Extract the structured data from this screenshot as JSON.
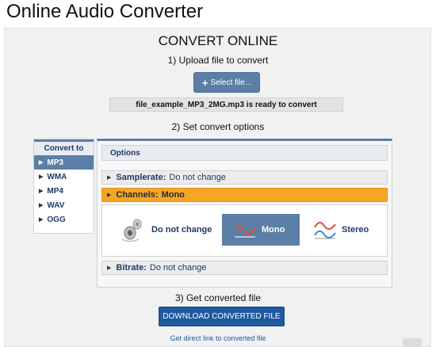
{
  "app": {
    "title": "Online Audio Converter"
  },
  "main": {
    "heading": "CONVERT ONLINE",
    "step1": "1) Upload file to convert",
    "select_file_label": "Select file...",
    "file_status": "file_example_MP3_2MG.mp3 is ready to convert",
    "step2": "2) Set convert options",
    "step3": "3) Get converted file",
    "download_label": "DOWNLOAD CONVERTED FILE",
    "direct_link": "Get direct link to converted file"
  },
  "sidebar": {
    "header": "Convert to",
    "items": [
      {
        "label": "MP3",
        "active": true
      },
      {
        "label": "WMA",
        "active": false
      },
      {
        "label": "MP4",
        "active": false
      },
      {
        "label": "WAV",
        "active": false
      },
      {
        "label": "OGG",
        "active": false
      }
    ]
  },
  "options": {
    "header": "Options",
    "samplerate": {
      "name": "Samplerate:",
      "value": "Do not change"
    },
    "channels": {
      "name": "Channels:",
      "value": "Mono",
      "choices": [
        {
          "label": "Do not change",
          "icon": "speaker-icon",
          "selected": false
        },
        {
          "label": "Mono",
          "icon": "mono-wave-icon",
          "selected": true
        },
        {
          "label": "Stereo",
          "icon": "stereo-wave-icon",
          "selected": false
        }
      ]
    },
    "bitrate": {
      "name": "Bitrate:",
      "value": "Do not change"
    }
  },
  "colors": {
    "accent": "#5b7fa6",
    "highlight": "#f5a623",
    "button": "#1f5aa0"
  }
}
